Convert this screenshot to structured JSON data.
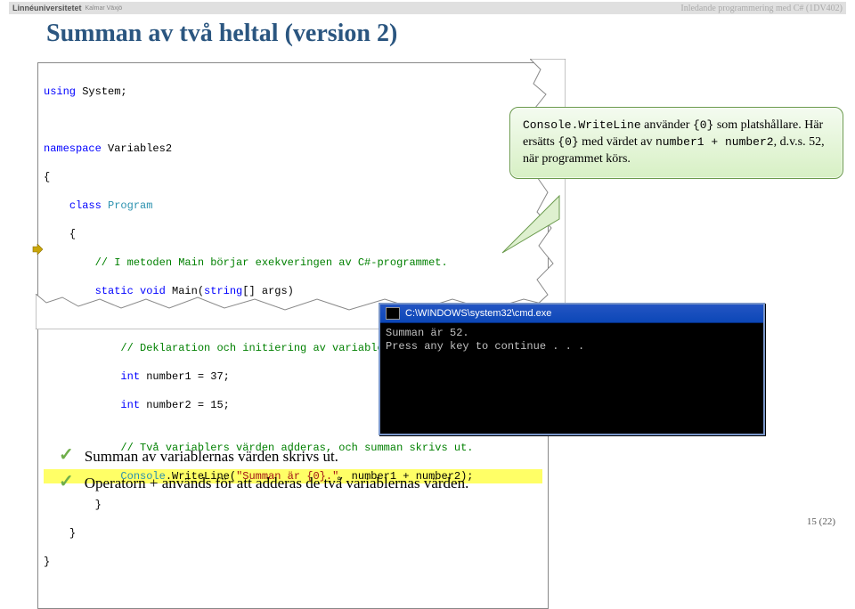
{
  "header": {
    "university": "Linnéuniversitetet",
    "subunit": "Kalmar Växjö",
    "course": "Inledande programmering med C# (1DV402)"
  },
  "title": "Summan av två heltal (version 2)",
  "code": {
    "l1_kw1": "using",
    "l1_sp": " System;",
    "l2_kw1": "namespace",
    "l2_sp": " Variables2",
    "l3": "{",
    "l4_kw1": "class",
    "l4_sp": " ",
    "l4_cls": "Program",
    "l5": "{",
    "l6_cm": "// I metoden Main börjar exekveringen av C#-programmet.",
    "l7_kw1": "static void",
    "l7_sp": " Main(",
    "l7_kw2": "string",
    "l7_rest": "[] args)",
    "l8": "{",
    "l9_cm": "// Deklaration och initiering av variabler.",
    "l10_kw": "int",
    "l10_rest": " number1 = 37;",
    "l11_kw": "int",
    "l11_rest": " number2 = 15;",
    "l12": "",
    "l13_cm": "// Två variablers värden adderas, och summan skrivs ut.",
    "l14_cls": "Console",
    "l14_mid": ".WriteLine(",
    "l14_str": "\"Summan är {0}.\"",
    "l14_end": ", number1 + number2);",
    "l15": "}",
    "l16": "}",
    "l17": "}"
  },
  "gutter_arrow_alt": "breakpoint-arrow",
  "callout": {
    "part1_mono1": "Console.WriteLine",
    "part1_txt1": " använder ",
    "part1_mono2": "{0}",
    "part2_txt1": " som platshållare. Här ersätts ",
    "part2_mono1": "{0}",
    "part2_txt2": " med värdet av ",
    "part2_mono2": "number1 + number2",
    "part2_txt3": ", d.v.s. 52, när programmet körs."
  },
  "cmd": {
    "title": "C:\\WINDOWS\\system32\\cmd.exe",
    "line1": "Summan är 52.",
    "line2": "Press any key to continue . . ."
  },
  "bullets": {
    "b1": "Summan av variablernas värden skrivs ut.",
    "b2": "Operatorn + används för att adderas de två variablernas värden."
  },
  "page_number": "15 (22)"
}
